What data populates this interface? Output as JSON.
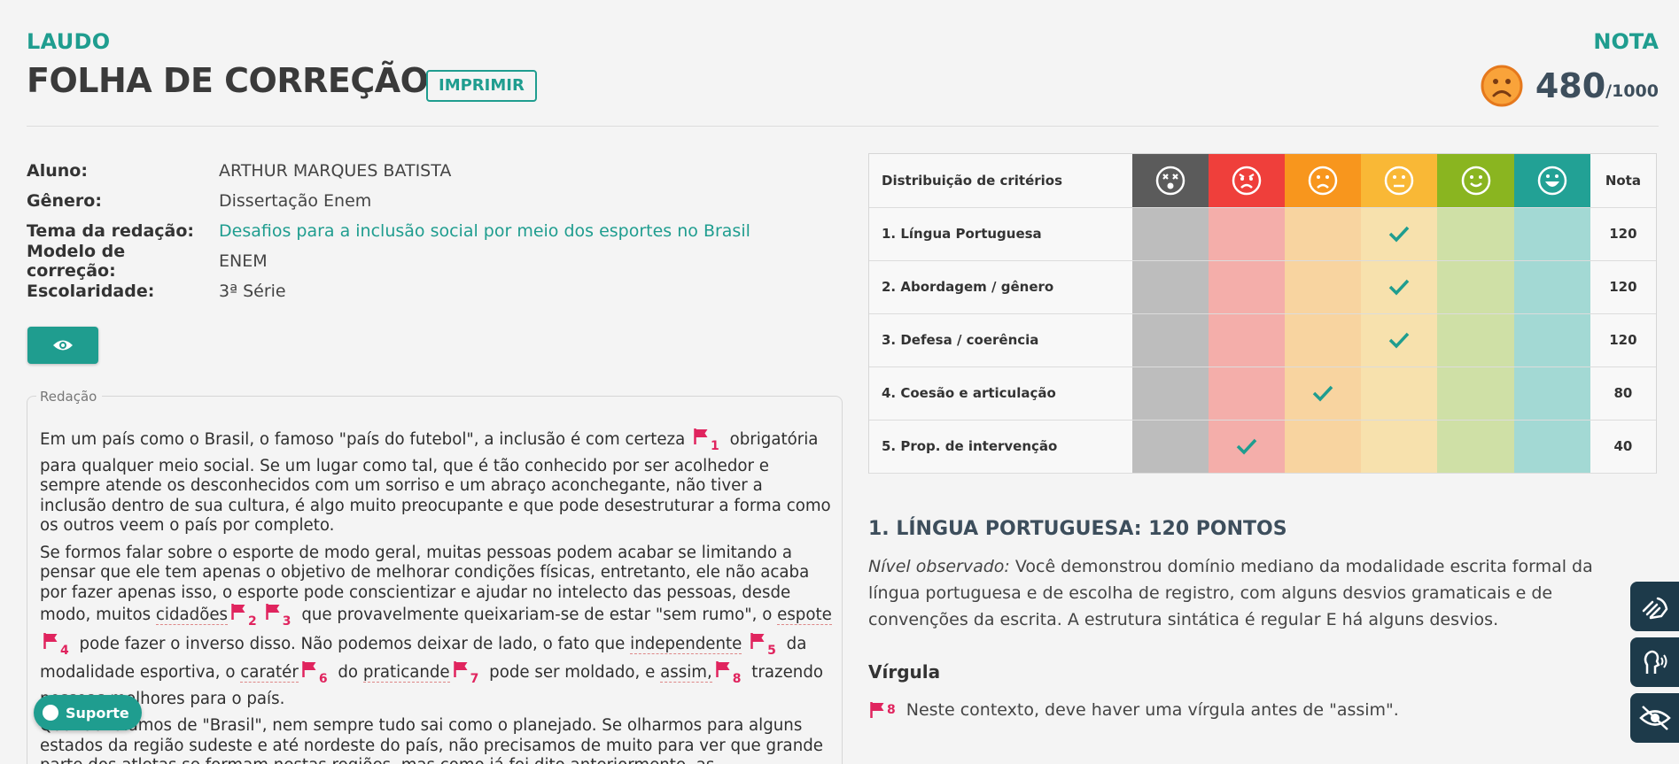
{
  "header": {
    "kicker": "LAUDO",
    "title": "FOLHA DE CORREÇÃO",
    "print_label": "IMPRIMIR",
    "nota_label": "NOTA",
    "score": "480",
    "score_max": "/1000"
  },
  "info": [
    {
      "key": "Aluno:",
      "value": "ARTHUR MARQUES BATISTA"
    },
    {
      "key": "Gênero:",
      "value": "Dissertação Enem"
    },
    {
      "key": "Tema da redação:",
      "value": "Desafios para a inclusão social por meio dos esportes no Brasil"
    },
    {
      "key": "Modelo de correção:",
      "value": "ENEM"
    },
    {
      "key": "Escolaridade:",
      "value": "3ª Série"
    }
  ],
  "essay": {
    "legend": "Redação",
    "p1a": "Em um país como o Brasil, o famoso \"país do futebol\", a inclusão é com certeza",
    "p1b": "obrigatória para qualquer meio social. Se um lugar como tal, que é tão conhecido por ser acolhedor e sempre atende os desconhecidos com um sorriso e um abraço aconchegante, não tiver a inclusão dentro de sua cultura, é algo muito preocupante e que pode desestruturar a forma como os outros veem o país por completo.",
    "p2a": "Se formos falar sobre o esporte de modo geral, muitas pessoas podem acabar se limitando a pensar que ele tem apenas o objetivo de melhorar condições físicas, entretanto, ele não acaba por fazer apenas isso, o esporte pode conscientizar e ajudar no intelecto das pessoas, desde modo, muitos",
    "w_cidadoes": "cidadões",
    "p2b": "que provavelmente queixariam-se de estar \"sem rumo\", o",
    "w_espote": "espote",
    "p2c": "pode fazer o inverso disso. Não podemos deixar de lado, o fato que",
    "w_independente": "independente",
    "p2d": "da modalidade esportiva, o",
    "w_carater": "caratér",
    "p2e": "do",
    "w_praticande": "praticande",
    "p2f": "pode ser moldado, e",
    "w_assim": "assim,",
    "p2g": "trazendo pessoas melhores para o país.",
    "p3": "Quando falamos de \"Brasil\", nem sempre tudo sai como o planejado. Se olharmos para alguns estados da região sudeste e até nordeste do país, não precisamos de muito para ver que grande parte dos atletas se formam nestas regiões, mas como já foi dito anteriormente, as",
    "flags": [
      "1",
      "2",
      "3",
      "4",
      "5",
      "6",
      "7",
      "8"
    ]
  },
  "support_label": "Suporte",
  "criteria": {
    "header_label": "Distribuição de critérios",
    "nota_header": "Nota",
    "level_icons": [
      "dizzy-face-icon",
      "angry-face-icon",
      "sad-face-icon",
      "neutral-face-icon",
      "smile-face-icon",
      "grin-face-icon"
    ],
    "level_colors": [
      "#5b5b5b",
      "#ef3f3b",
      "#f8961d",
      "#f9b836",
      "#8ab520",
      "#22a195"
    ],
    "rows": [
      {
        "name": "1. Língua Portuguesa",
        "level": 3,
        "nota": "120"
      },
      {
        "name": "2. Abordagem / gênero",
        "level": 3,
        "nota": "120"
      },
      {
        "name": "3. Defesa / coerência",
        "level": 3,
        "nota": "120"
      },
      {
        "name": "4. Coesão e articulação",
        "level": 2,
        "nota": "80"
      },
      {
        "name": "5. Prop. de intervenção",
        "level": 1,
        "nota": "40"
      }
    ]
  },
  "detail": {
    "title": "1. LÍNGUA PORTUGUESA: 120 PONTOS",
    "observed_label": "Nível observado:",
    "observed_text": "Você demonstrou domínio mediano da modalidade escrita formal da língua portuguesa e de escolha de registro, com alguns desvios gramaticais e de convenções da escrita. A estrutura sintática é regular E há alguns desvios.",
    "section": "Vírgula",
    "note_flag": "8",
    "note_text": "Neste contexto, deve haver uma vírgula antes de \"assim\"."
  },
  "accessibility": [
    "sign-language-icon",
    "audio-reader-icon",
    "visual-contrast-icon"
  ]
}
